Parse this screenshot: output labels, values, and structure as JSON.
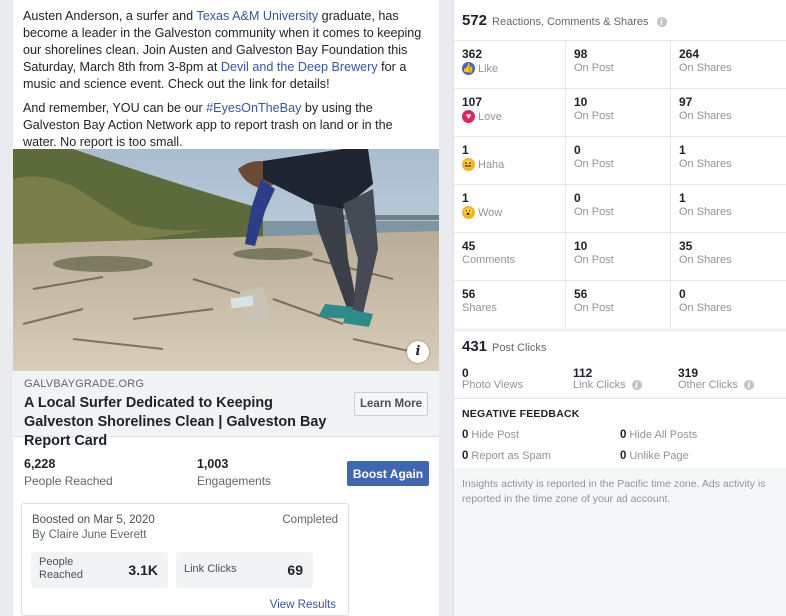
{
  "post": {
    "paragraph1_a": "Austen Anderson, a surfer and ",
    "paragraph1_link1": "Texas A&M University",
    "paragraph1_b": " graduate, has become a leader in the Galveston community when it comes to keeping our shorelines clean. Join Austen and Galveston Bay Foundation this Saturday, March 8th from 3-8pm at ",
    "paragraph1_link2": "Devil and the Deep Brewery",
    "paragraph1_c": " for a music and science event. Check out the link for details!",
    "paragraph2_a": "And remember, YOU can be our ",
    "paragraph2_hashtag": "#EyesOnTheBay",
    "paragraph2_b": " by using the Galveston Bay Action Network app to report trash on land or in the water. No report is too small.",
    "info_icon": "i"
  },
  "link_card": {
    "domain": "GALVBAYGRADE.ORG",
    "title": "A Local Surfer Dedicated to Keeping Galveston Shorelines Clean | Galveston Bay Report Card",
    "button": "Learn More"
  },
  "stats": {
    "people_reached_value": "6,228",
    "people_reached_label": "People Reached",
    "engagements_value": "1,003",
    "engagements_label": "Engagements",
    "boost_again": "Boost Again"
  },
  "boost": {
    "boosted_on": "Boosted on Mar 5, 2020",
    "by": "By Claire June Everett",
    "status": "Completed",
    "people_reached_label": "People Reached",
    "people_reached_value": "3.1K",
    "link_clicks_label": "Link Clicks",
    "link_clicks_value": "69",
    "view_results": "View Results"
  },
  "insights": {
    "total": "572",
    "total_label": "Reactions, Comments & Shares",
    "rows": [
      {
        "n1": "362",
        "l1": "Like",
        "icon": "like-icon",
        "color": "#4267b2",
        "n2": "98",
        "l2": "On Post",
        "n3": "264",
        "l3": "On Shares"
      },
      {
        "n1": "107",
        "l1": "Love",
        "icon": "love-icon",
        "color": "#e0245e",
        "n2": "10",
        "l2": "On Post",
        "n3": "97",
        "l3": "On Shares"
      },
      {
        "n1": "1",
        "l1": "Haha",
        "icon": "haha-icon",
        "color": "#f7b125",
        "n2": "0",
        "l2": "On Post",
        "n3": "1",
        "l3": "On Shares"
      },
      {
        "n1": "1",
        "l1": "Wow",
        "icon": "wow-icon",
        "color": "#f7b125",
        "n2": "0",
        "l2": "On Post",
        "n3": "1",
        "l3": "On Shares"
      },
      {
        "n1": "45",
        "l1": "Comments",
        "icon": "",
        "color": "",
        "n2": "10",
        "l2": "On Post",
        "n3": "35",
        "l3": "On Shares"
      },
      {
        "n1": "56",
        "l1": "Shares",
        "icon": "",
        "color": "",
        "n2": "56",
        "l2": "On Post",
        "n3": "0",
        "l3": "On Shares"
      }
    ],
    "clicks_total": "431",
    "clicks_label": "Post Clicks",
    "photo_views_value": "0",
    "photo_views_label": "Photo Views",
    "link_clicks_value": "112",
    "link_clicks_label": "Link Clicks",
    "other_clicks_value": "319",
    "other_clicks_label": "Other Clicks",
    "negative_title": "NEGATIVE FEEDBACK",
    "hide_post_value": "0",
    "hide_post_label": "Hide Post",
    "hide_all_value": "0",
    "hide_all_label": "Hide All Posts",
    "spam_value": "0",
    "spam_label": "Report as Spam",
    "unlike_value": "0",
    "unlike_label": "Unlike Page",
    "footnote": "Insights activity is reported in the Pacific time zone. Ads activity is reported in the time zone of your ad account."
  }
}
